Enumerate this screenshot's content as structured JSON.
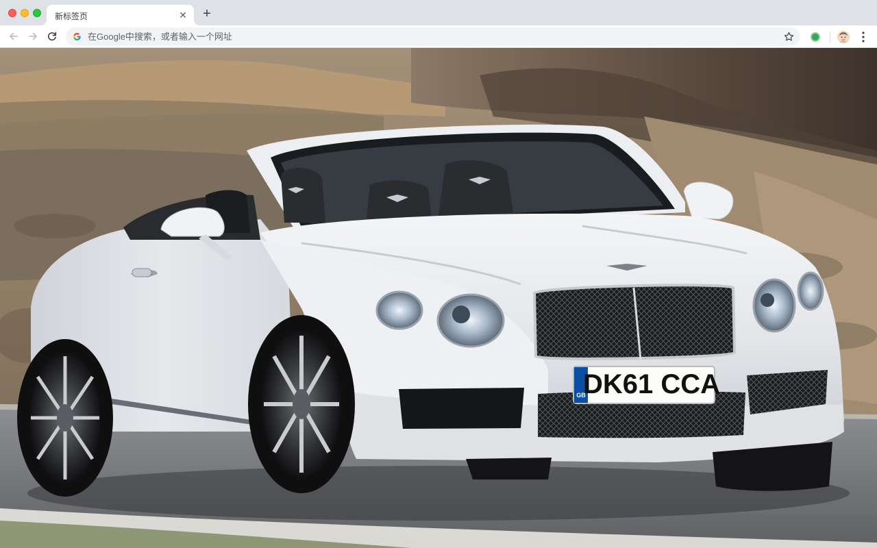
{
  "window": {
    "tab": {
      "title": "新标签页"
    },
    "new_tab_symbol": "+"
  },
  "toolbar": {
    "omnibox": {
      "placeholder": "在Google中搜索，或者输入一个网址",
      "value": ""
    },
    "icons": [
      "back-arrow-icon",
      "forward-arrow-icon",
      "reload-icon",
      "google-g-icon",
      "bookmark-star-icon",
      "extension-icon",
      "profile-avatar-icon",
      "more-menu-icon"
    ]
  },
  "wallpaper": {
    "license_plate": "DK61 CCA",
    "plate_country": "GB"
  },
  "colors": {
    "tabstrip_bg": "#dee1e6",
    "toolbar_bg": "#ffffff",
    "omnibox_bg": "#f1f3f4",
    "car_body": "#e8e9eb"
  }
}
